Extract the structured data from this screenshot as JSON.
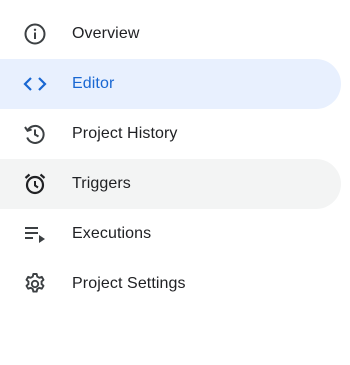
{
  "nav": {
    "items": [
      {
        "label": "Overview",
        "icon": "info-icon",
        "active": false
      },
      {
        "label": "Editor",
        "icon": "code-icon",
        "active": true
      },
      {
        "label": "Project History",
        "icon": "history-icon",
        "active": false
      },
      {
        "label": "Triggers",
        "icon": "alarm-icon",
        "active": false,
        "hovered": true
      },
      {
        "label": "Executions",
        "icon": "playlist-play-icon",
        "active": false
      },
      {
        "label": "Project Settings",
        "icon": "gear-icon",
        "active": false
      }
    ]
  },
  "colors": {
    "active_bg": "#e8f0fe",
    "active_fg": "#1967d2",
    "hover_bg": "#f3f4f4",
    "text": "#202124",
    "icon": "#3c4043"
  }
}
